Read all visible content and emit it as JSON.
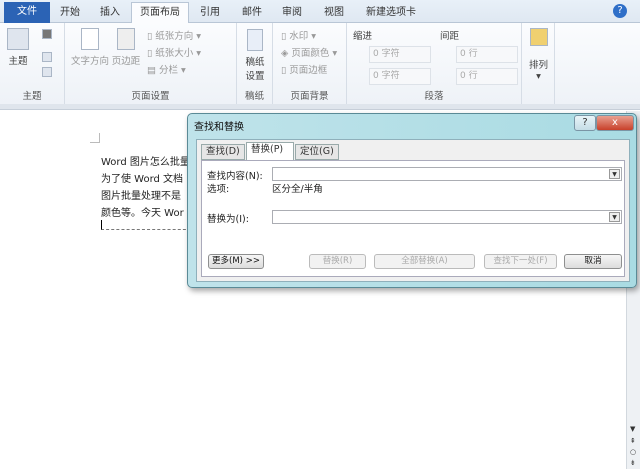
{
  "tabs": [
    "文件",
    "开始",
    "插入",
    "页面布局",
    "引用",
    "邮件",
    "审阅",
    "视图",
    "新建选项卡"
  ],
  "ribbon": {
    "theme": {
      "label": "主题",
      "button": "主题"
    },
    "page_setup": {
      "label": "页面设置",
      "text_direction": "文字方向",
      "margins": "页边距",
      "orientation": "纸张方向",
      "size": "纸张大小",
      "columns": "分栏"
    },
    "paper": {
      "label": "稿纸",
      "button1": "稿纸",
      "button2": "设置"
    },
    "background": {
      "label": "页面背景",
      "watermark": "水印",
      "page_color": "页面颜色",
      "page_borders": "页面边框"
    },
    "paragraph": {
      "label": "段落",
      "indent": "缩进",
      "spacing": "间距",
      "indent_left": "0 字符",
      "indent_right": "0 字符",
      "spacing_before": "0 行",
      "spacing_after": "0 行"
    },
    "arrange": {
      "label": "排列"
    }
  },
  "document": {
    "lines": [
      "Word 图片怎么批量",
      "为了使 Word 文档",
      "图片批量处理不是",
      "颜色等。今天 Wor"
    ]
  },
  "dialog": {
    "title": "查找和替换",
    "help": "?",
    "close": "x",
    "tabs": [
      "查找(D)",
      "替换(P)",
      "定位(G)"
    ],
    "find_label": "查找内容(N):",
    "find_value": "",
    "options_label": "选项:",
    "options_value": "区分全/半角",
    "replace_label": "替换为(I):",
    "replace_value": "",
    "buttons": {
      "more": "更多(M) >>",
      "replace": "替换(R)",
      "replace_all": "全部替换(A)",
      "find_next": "查找下一处(F)",
      "cancel": "取消"
    }
  }
}
